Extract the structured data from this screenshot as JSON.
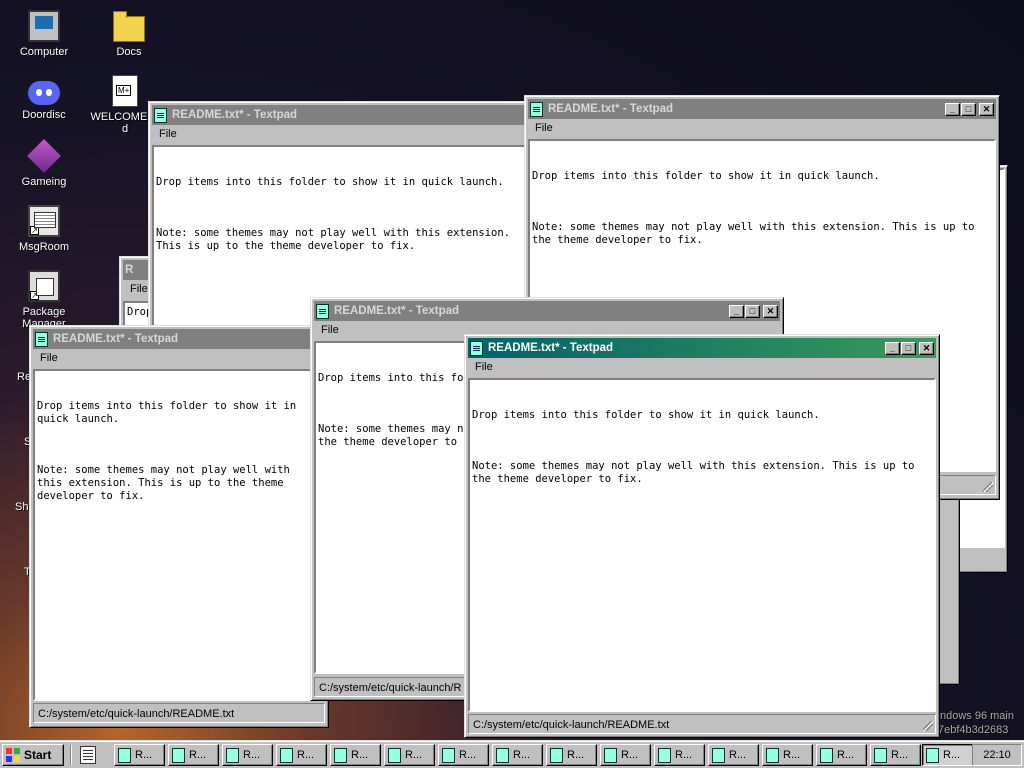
{
  "desktop": {
    "icons": [
      {
        "label": "Computer"
      },
      {
        "label": "Docs"
      },
      {
        "label": "Doordisc"
      },
      {
        "label": "WELCOME.md"
      },
      {
        "label": "Gameing"
      },
      {
        "label": "MsgRoom"
      },
      {
        "label": "Package Manager"
      }
    ],
    "partial_labels": [
      "Re",
      "S",
      "Sha",
      "T"
    ],
    "watermark": [
      "ndows 96 main",
      "7ebf4b3d2683"
    ]
  },
  "window_common": {
    "title": "README.txt* - Textpad",
    "menu_file": "File",
    "line1": "Drop items into this folder to show it in quick launch.",
    "line2": "Note: some themes may not play well with this extension. This is up to the theme developer to fix.",
    "status_path": "C:/system/etc/quick-launch/README.txt",
    "status_path_cut": "C:/system/etc/quick-launch/R",
    "fragment_drop": "Drop",
    "fragment_r": "R",
    "minimize": "_",
    "maximize": "□",
    "close": "✕"
  },
  "taskbar": {
    "start_label": "Start",
    "task_label": "R...",
    "clock": "22:10",
    "colors": {
      "active_title": "#000080",
      "teal_title": "#06606a"
    }
  }
}
